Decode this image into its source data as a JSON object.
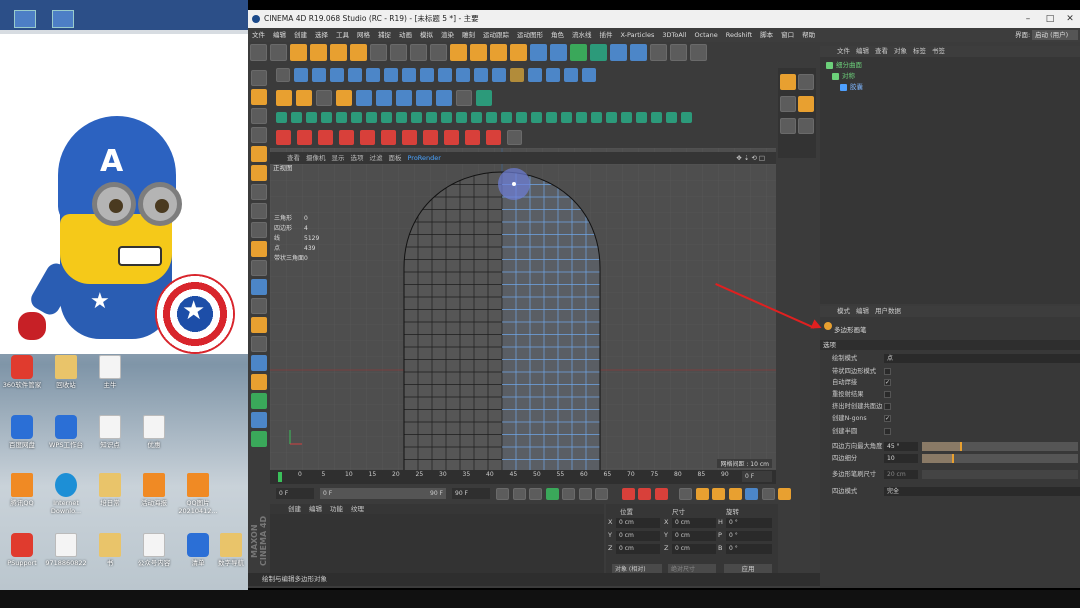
{
  "desktop": {
    "icons": [
      {
        "label": "360软件管家"
      },
      {
        "label": "回收站"
      },
      {
        "label": "主牛"
      },
      {
        "label": "百度网盘"
      },
      {
        "label": "WPS工作台"
      },
      {
        "label": "知识点"
      },
      {
        "label": "优惠"
      },
      {
        "label": "腾讯QQ"
      },
      {
        "label": "Internet Downlo..."
      },
      {
        "label": "培日常"
      },
      {
        "label": "活动海报"
      },
      {
        "label": "QQ图片 20210412..."
      },
      {
        "label": "PSupport"
      },
      {
        "label": "9718860822"
      },
      {
        "label": "书"
      },
      {
        "label": "公众号内容"
      },
      {
        "label": "清单"
      },
      {
        "label": "数字导航"
      }
    ]
  },
  "app": {
    "title": "CINEMA 4D R19.068 Studio (RC - R19) - [未标题 5 *] - 主要",
    "menu": [
      "文件",
      "编辑",
      "创建",
      "选择",
      "工具",
      "网格",
      "捕捉",
      "动画",
      "模拟",
      "渲染",
      "雕刻",
      "运动跟踪",
      "运动图形",
      "角色",
      "流水线",
      "插件",
      "X-Particles",
      "3DToAll",
      "Octane",
      "Redshift",
      "脚本",
      "窗口",
      "帮助"
    ],
    "interface_label": "界面:",
    "interface_value": "启动 (用户)"
  },
  "viewport": {
    "menu": [
      "查看",
      "摄像机",
      "显示",
      "选项",
      "过滤",
      "面板",
      "ProRender"
    ],
    "label": "正视图",
    "stats": [
      {
        "k": "三角形",
        "v": "0"
      },
      {
        "k": "四边形",
        "v": "4"
      },
      {
        "k": "线",
        "v": "5129"
      },
      {
        "k": "点",
        "v": "439"
      },
      {
        "k": "带状三角面",
        "v": "0"
      }
    ],
    "grid_distance": "网格间距 : 10 cm"
  },
  "timeline": {
    "ticks": [
      "0",
      "5",
      "10",
      "15",
      "20",
      "25",
      "30",
      "35",
      "40",
      "45",
      "50",
      "55",
      "60",
      "65",
      "70",
      "75",
      "80",
      "85",
      "90"
    ],
    "end_frame": "0 F",
    "start_field": "0 F",
    "current_field": "0 F",
    "max_field": "90 F",
    "range_end": "90 F"
  },
  "lower_left": {
    "menu": [
      "创建",
      "编辑",
      "功能",
      "纹理"
    ]
  },
  "coordinates": {
    "headers": [
      "位置",
      "尺寸",
      "旋转"
    ],
    "rows": [
      {
        "axis": "X",
        "pos": "0 cm",
        "size_axis": "X",
        "size": "0 cm",
        "rot_axis": "H",
        "rot": "0 °"
      },
      {
        "axis": "Y",
        "pos": "0 cm",
        "size_axis": "Y",
        "size": "0 cm",
        "rot_axis": "P",
        "rot": "0 °"
      },
      {
        "axis": "Z",
        "pos": "0 cm",
        "size_axis": "Z",
        "size": "0 cm",
        "rot_axis": "B",
        "rot": "0 °"
      }
    ],
    "mode": "对象 (相对)",
    "size_mode": "绝对尺寸",
    "apply": "应用"
  },
  "status": "绘制与编辑多边形对象",
  "object_manager": {
    "menu": [
      "文件",
      "编辑",
      "查看",
      "对象",
      "标签",
      "书签"
    ],
    "objects": [
      {
        "name": "细分曲面"
      },
      {
        "name": "对称"
      },
      {
        "name": "胶囊"
      }
    ]
  },
  "attribute_manager": {
    "menu": [
      "模式",
      "编辑",
      "用户数据"
    ],
    "tool_title": "多边形画笔",
    "section": "选项",
    "rows": [
      {
        "label": "绘制模式",
        "value": "点"
      },
      {
        "label": "带状四边形模式",
        "checked": false
      },
      {
        "label": "自动焊接",
        "checked": true
      },
      {
        "label": "重投射结果",
        "checked": false
      },
      {
        "label": "挤出时创建共面边",
        "checked": false
      },
      {
        "label": "创建N-gons",
        "checked": true
      },
      {
        "label": "创建半圆",
        "checked": false
      },
      {
        "label": "四边方向最大角度",
        "value": "45 °",
        "fill": 0.25
      },
      {
        "label": "四边细分",
        "value": "10",
        "fill": 0.2
      },
      {
        "label": "多边形笔刷尺寸",
        "value": "20 cm"
      },
      {
        "label": "四边模式",
        "value": "完全"
      }
    ]
  },
  "colors": {
    "accent_orange": "#e8a030",
    "annotation_red": "#e02020",
    "object_green": "#6cd07a",
    "selection_blue": "#4ea0ff"
  }
}
